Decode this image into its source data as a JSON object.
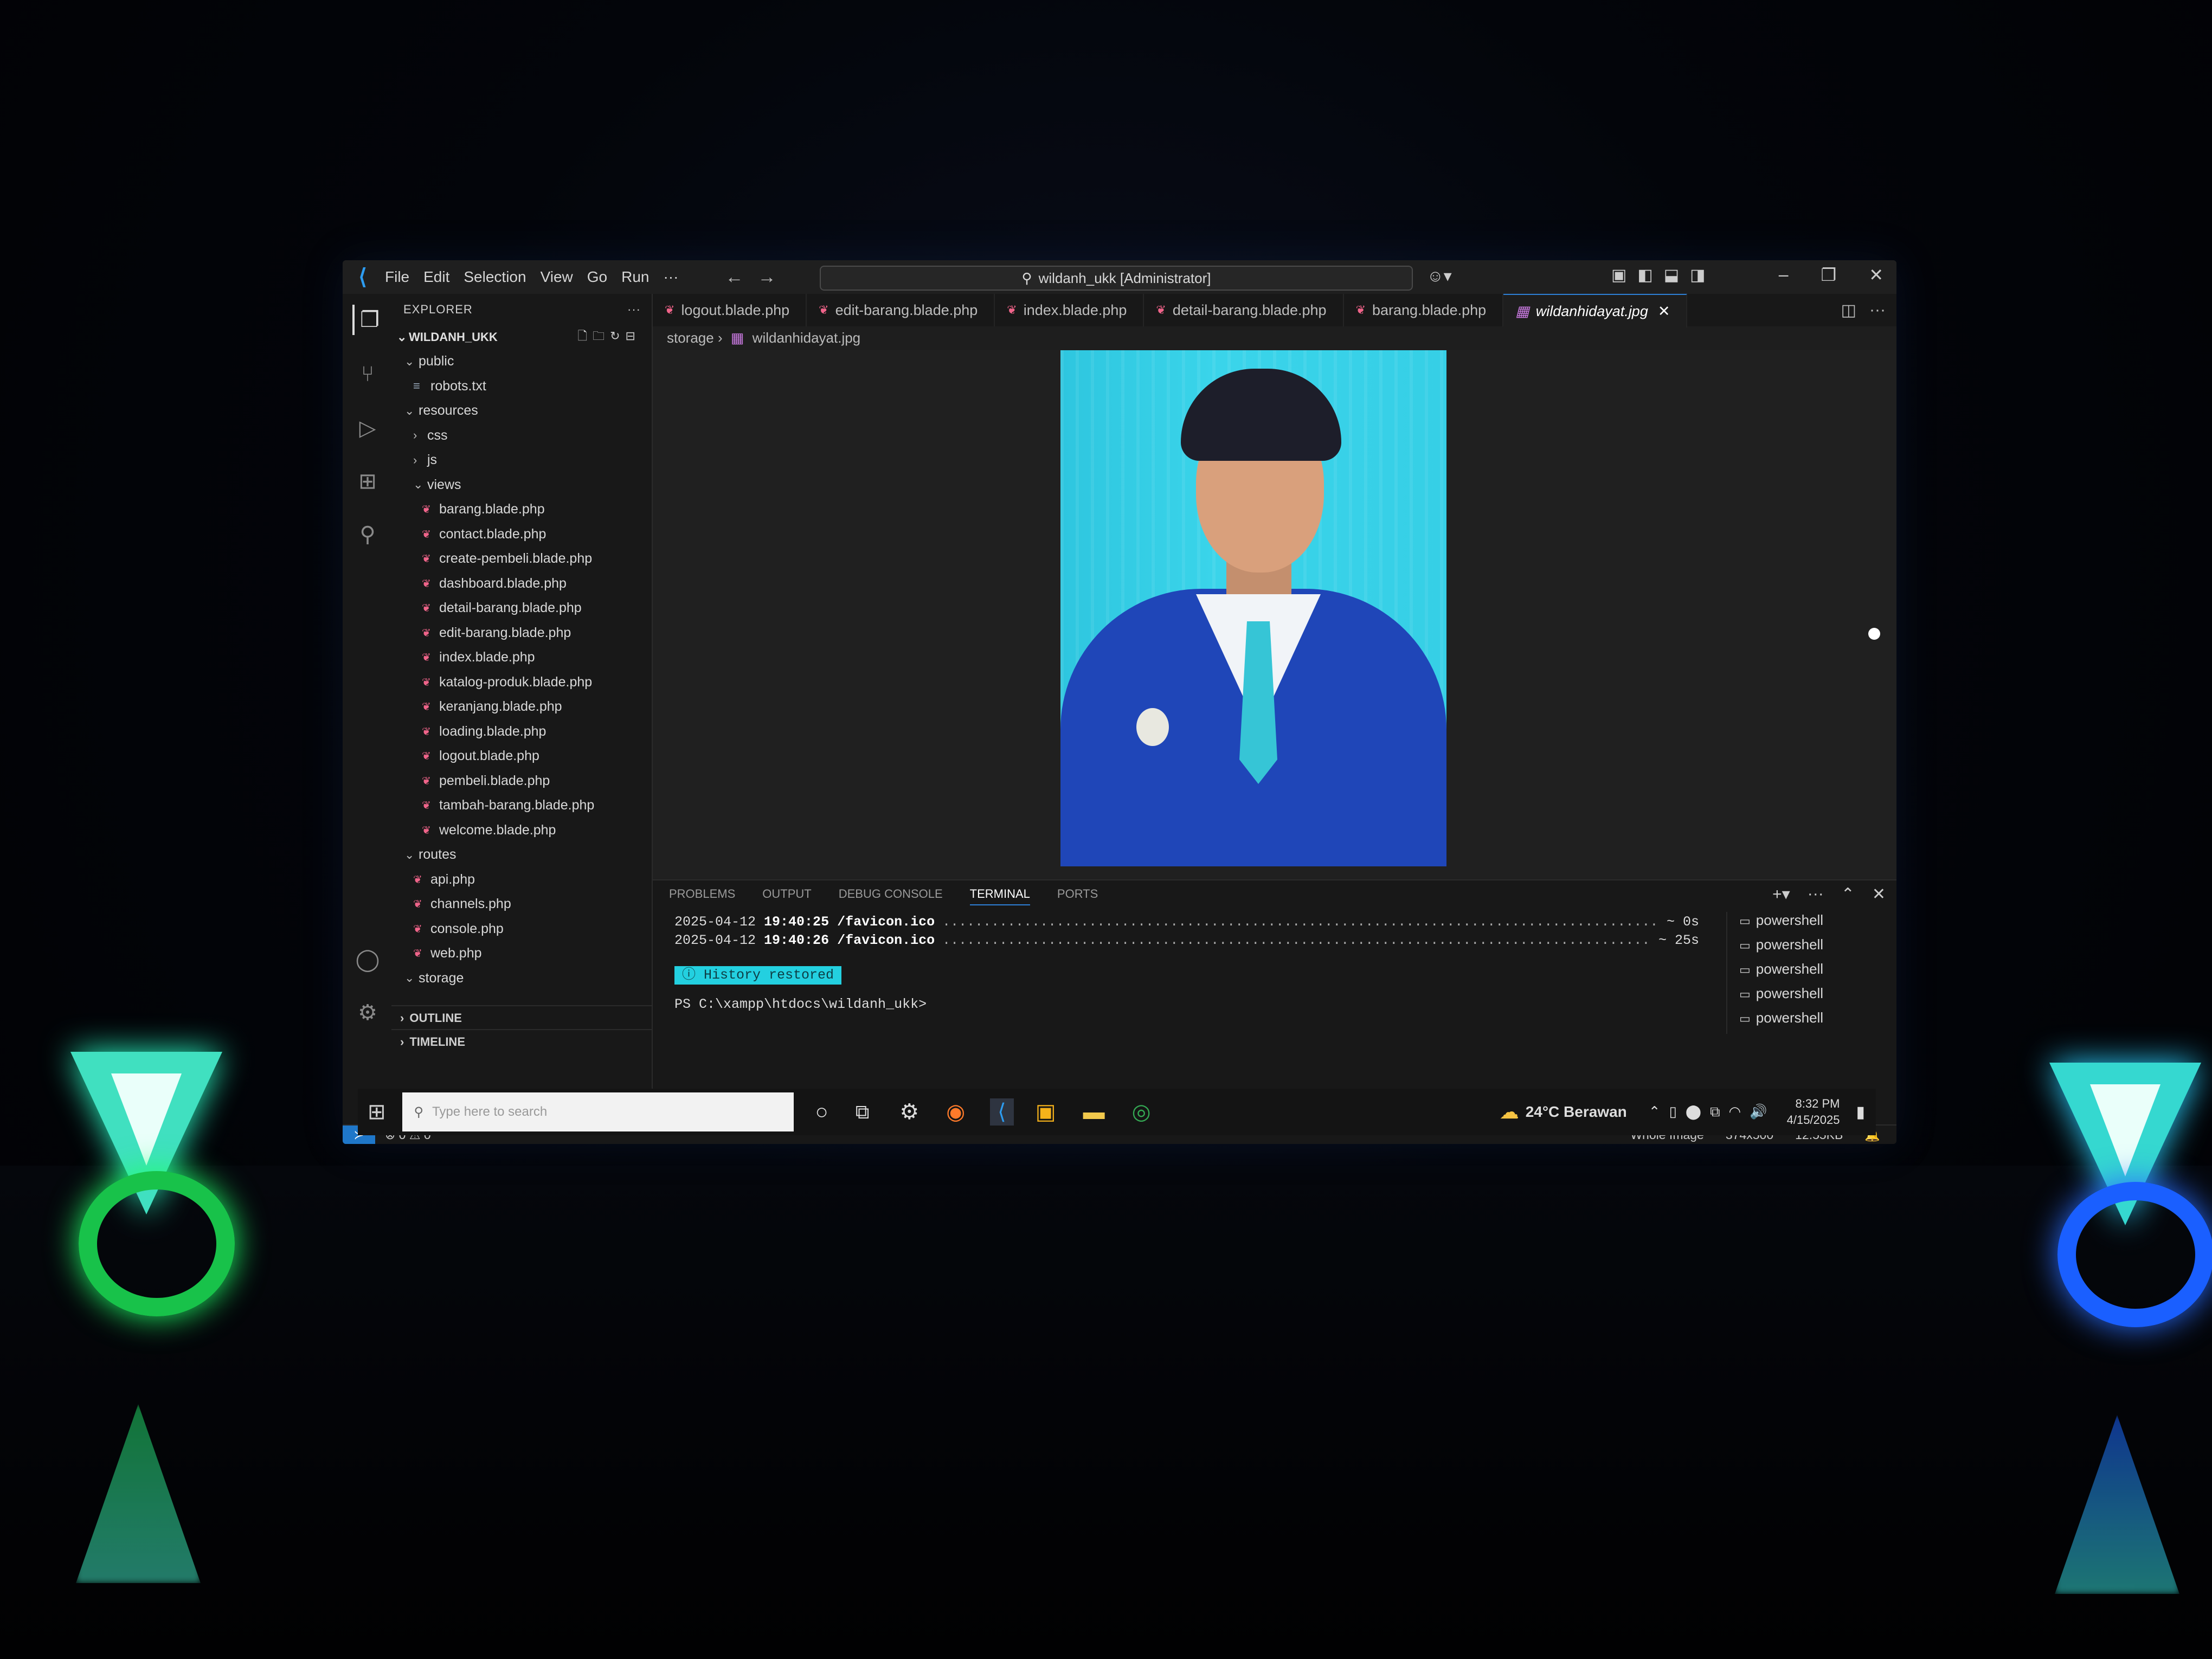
{
  "titlebar": {
    "menu": [
      "File",
      "Edit",
      "Selection",
      "View",
      "Go",
      "Run",
      "···"
    ],
    "command_center": "wildanh_ukk [Administrator]"
  },
  "explorer": {
    "title": "EXPLORER",
    "workspace": "WILDANH_UKK",
    "tree": [
      {
        "label": "public",
        "type": "folder-open",
        "depth": 1
      },
      {
        "label": "robots.txt",
        "type": "txt",
        "depth": 2
      },
      {
        "label": "resources",
        "type": "folder-open",
        "depth": 1
      },
      {
        "label": "css",
        "type": "folder",
        "depth": 2
      },
      {
        "label": "js",
        "type": "folder",
        "depth": 2
      },
      {
        "label": "views",
        "type": "folder-open",
        "depth": 2
      },
      {
        "label": "barang.blade.php",
        "type": "blade",
        "depth": 3
      },
      {
        "label": "contact.blade.php",
        "type": "blade",
        "depth": 3
      },
      {
        "label": "create-pembeli.blade.php",
        "type": "blade",
        "depth": 3
      },
      {
        "label": "dashboard.blade.php",
        "type": "blade",
        "depth": 3
      },
      {
        "label": "detail-barang.blade.php",
        "type": "blade",
        "depth": 3
      },
      {
        "label": "edit-barang.blade.php",
        "type": "blade",
        "depth": 3
      },
      {
        "label": "index.blade.php",
        "type": "blade",
        "depth": 3
      },
      {
        "label": "katalog-produk.blade.php",
        "type": "blade",
        "depth": 3
      },
      {
        "label": "keranjang.blade.php",
        "type": "blade",
        "depth": 3
      },
      {
        "label": "loading.blade.php",
        "type": "blade",
        "depth": 3
      },
      {
        "label": "logout.blade.php",
        "type": "blade",
        "depth": 3
      },
      {
        "label": "pembeli.blade.php",
        "type": "blade",
        "depth": 3
      },
      {
        "label": "tambah-barang.blade.php",
        "type": "blade",
        "depth": 3
      },
      {
        "label": "welcome.blade.php",
        "type": "blade",
        "depth": 3
      },
      {
        "label": "routes",
        "type": "folder-open",
        "depth": 1
      },
      {
        "label": "api.php",
        "type": "php",
        "depth": 2
      },
      {
        "label": "channels.php",
        "type": "php",
        "depth": 2
      },
      {
        "label": "console.php",
        "type": "php",
        "depth": 2
      },
      {
        "label": "web.php",
        "type": "php",
        "depth": 2
      },
      {
        "label": "storage",
        "type": "folder-open",
        "depth": 1
      }
    ],
    "outline": "OUTLINE",
    "timeline": "TIMELINE"
  },
  "tabs": [
    {
      "label": "logout.blade.php",
      "active": false
    },
    {
      "label": "edit-barang.blade.php",
      "active": false
    },
    {
      "label": "index.blade.php",
      "active": false
    },
    {
      "label": "detail-barang.blade.php",
      "active": false
    },
    {
      "label": "barang.blade.php",
      "active": false
    },
    {
      "label": "wildanhidayat.jpg",
      "active": true
    }
  ],
  "breadcrumb": {
    "folder": "storage",
    "file": "wildanhidayat.jpg"
  },
  "panel": {
    "tabs": [
      "PROBLEMS",
      "OUTPUT",
      "DEBUG CONSOLE",
      "TERMINAL",
      "PORTS"
    ],
    "active_tab": "TERMINAL",
    "log": [
      {
        "date": "2025-04-12",
        "time": "19:40:25",
        "path": "/favicon.ico",
        "duration": "~ 0s"
      },
      {
        "date": "2025-04-12",
        "time": "19:40:26",
        "path": "/favicon.ico",
        "duration": "~ 25s"
      }
    ],
    "history_badge": "History restored",
    "prompt": "PS C:\\xampp\\htdocs\\wildanh_ukk>",
    "shells": [
      "powershell",
      "powershell",
      "powershell",
      "powershell",
      "powershell"
    ]
  },
  "statusbar": {
    "problems": "⊗ 0 ⚠ 0",
    "image_mode": "Whole Image",
    "dimensions": "374x500",
    "size": "12.55KB"
  },
  "taskbar": {
    "search_placeholder": "Type here to search",
    "weather": "24°C  Berawan",
    "time": "8:32 PM",
    "date": "4/15/2025"
  },
  "colors": {
    "accent": "#2d7fd6",
    "blade_icon": "#f0648a",
    "history_badge": "#23d0e0"
  }
}
